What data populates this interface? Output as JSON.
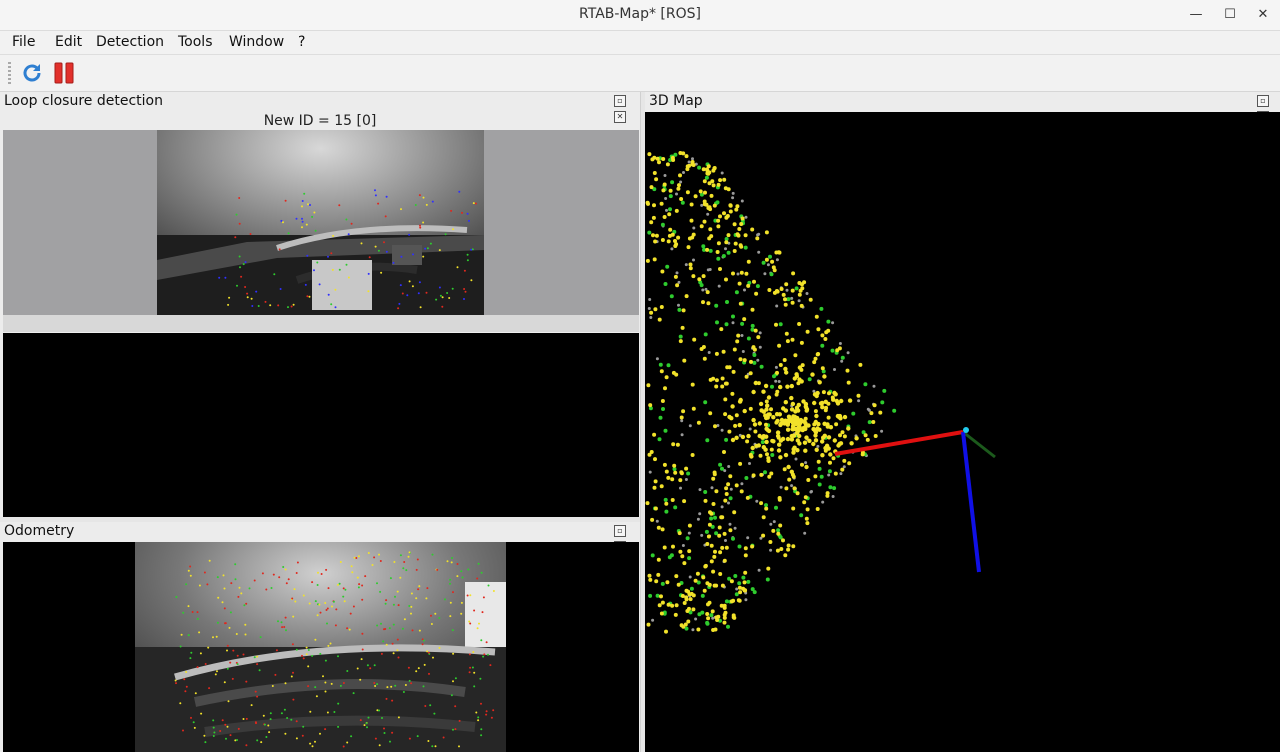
{
  "window": {
    "title": "RTAB-Map* [ROS]",
    "controls": {
      "minimize": "—",
      "maximize": "☐",
      "close": "✕"
    }
  },
  "menu": [
    "File",
    "Edit",
    "Detection",
    "Tools",
    "Window",
    "?"
  ],
  "toolbar": {
    "buttons": [
      {
        "icon": "refresh-icon",
        "color": "#2f7fd1"
      },
      {
        "icon": "pause-icon",
        "color": "#e2302b"
      }
    ]
  },
  "loop_closure": {
    "title": "Loop closure detection",
    "new_id_label": "New ID = 15 [0]"
  },
  "odometry": {
    "title": "Odometry"
  },
  "map3d": {
    "title": "3D Map",
    "axis_colors": {
      "x": "#e01010",
      "y": "#1c5a1c",
      "z": "#1010e6",
      "origin": "#22ccee"
    },
    "point_colors": {
      "yellow": "#f2e22a",
      "green": "#2ecc2e",
      "gray": "#9a9a9a",
      "red": "#e0281e"
    }
  }
}
